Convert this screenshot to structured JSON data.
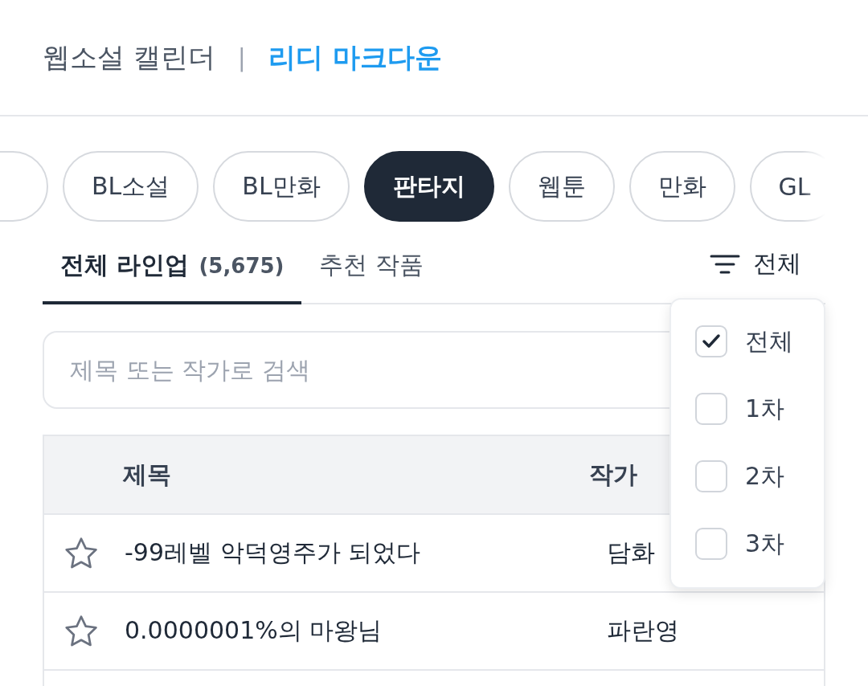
{
  "header": {
    "title": "웹소설 캘린더",
    "separator": "|",
    "brand": "리디 마크다운"
  },
  "categories": [
    {
      "label": "BL소설",
      "selected": false
    },
    {
      "label": "BL만화",
      "selected": false
    },
    {
      "label": "판타지",
      "selected": true
    },
    {
      "label": "웹툰",
      "selected": false
    },
    {
      "label": "만화",
      "selected": false
    },
    {
      "label": "GL",
      "selected": false
    }
  ],
  "tabs": [
    {
      "label": "전체 라인업",
      "count": "(5,675)",
      "selected": true
    },
    {
      "label": "추천 작품",
      "selected": false
    }
  ],
  "filter": {
    "label": "전체",
    "options": [
      {
        "label": "전체",
        "checked": true
      },
      {
        "label": "1차",
        "checked": false
      },
      {
        "label": "2차",
        "checked": false
      },
      {
        "label": "3차",
        "checked": false
      }
    ]
  },
  "search": {
    "placeholder": "제목 또는 작가로 검색"
  },
  "table": {
    "columns": [
      "제목",
      "작가"
    ],
    "rows": [
      {
        "title": "-99레벨 악덕영주가 되었다",
        "author": "담화",
        "starred": false
      },
      {
        "title": "0.0000001%의 마왕님",
        "author": "파란영",
        "starred": false
      }
    ]
  }
}
